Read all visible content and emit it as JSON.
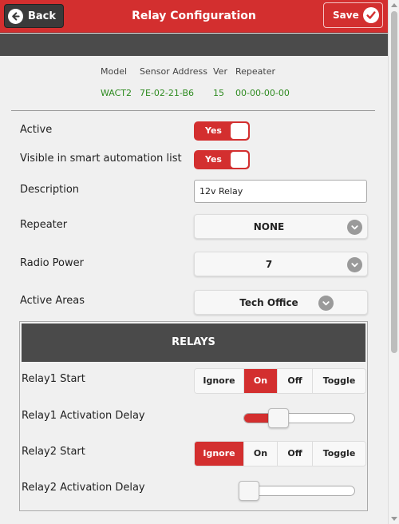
{
  "header": {
    "back_label": "Back",
    "title": "Relay Configuration",
    "save_label": "Save"
  },
  "info": {
    "headers": [
      "Model",
      "Sensor Address",
      "Ver",
      "Repeater"
    ],
    "values": [
      "WACT2",
      "7E-02-21-B6",
      "15",
      "00-00-00-00"
    ]
  },
  "fields": {
    "active": {
      "label": "Active",
      "value": "Yes"
    },
    "visible": {
      "label": "Visible in smart automation list",
      "value": "Yes"
    },
    "description": {
      "label": "Description",
      "value": "12v Relay"
    },
    "repeater": {
      "label": "Repeater",
      "value": "NONE"
    },
    "radio_power": {
      "label": "Radio Power",
      "value": "7"
    },
    "active_areas": {
      "label": "Active Areas",
      "value": "Tech Office"
    }
  },
  "relays": {
    "heading": "RELAYS",
    "options": [
      "Ignore",
      "On",
      "Off",
      "Toggle"
    ],
    "relay1_start": {
      "label": "Relay1 Start",
      "selected": "On"
    },
    "relay1_delay": {
      "label": "Relay1 Activation Delay",
      "level": 0.3
    },
    "relay2_start": {
      "label": "Relay2 Start",
      "selected": "Ignore"
    },
    "relay2_delay": {
      "label": "Relay2 Activation Delay",
      "level": 0.0
    }
  },
  "colors": {
    "accent": "#d32f2f",
    "dark": "#4a4a4a",
    "info_value": "#2e8b20"
  }
}
